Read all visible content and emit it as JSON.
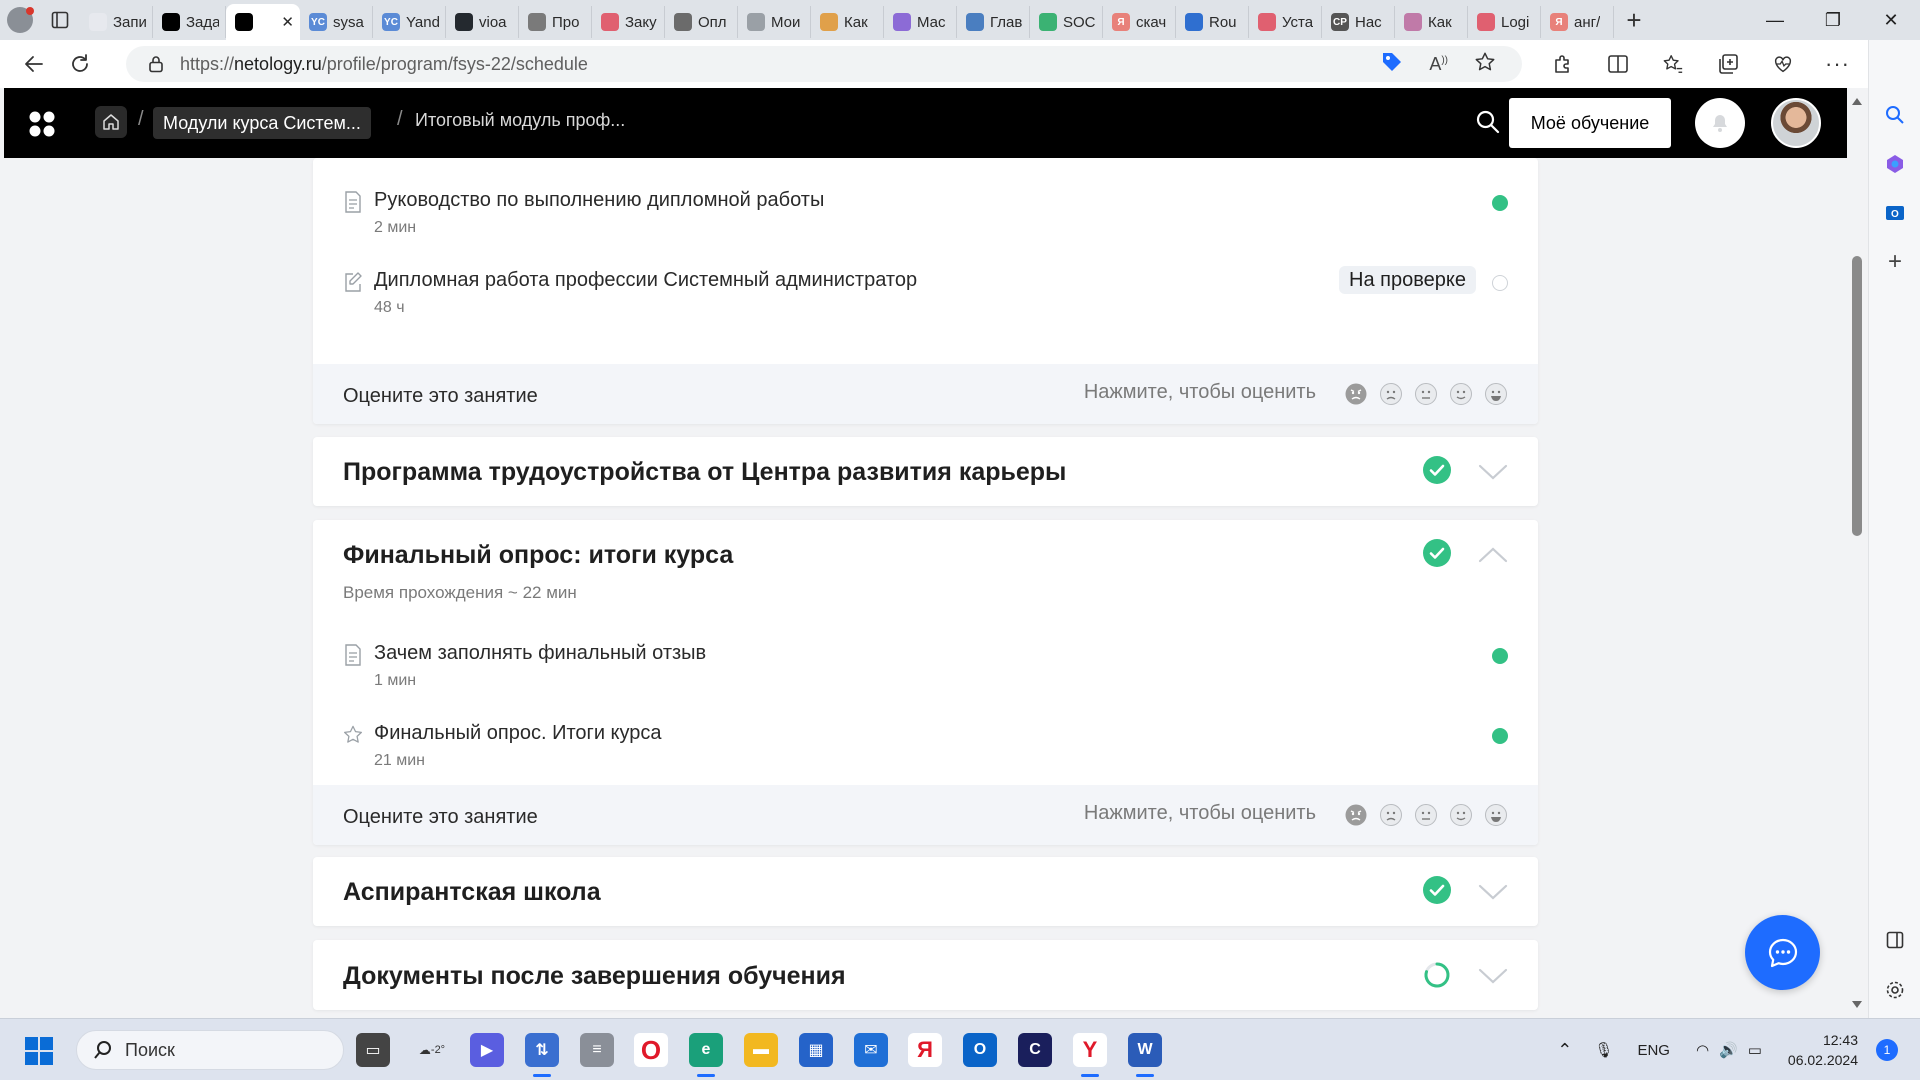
{
  "browser": {
    "tabs": [
      {
        "title": "Запи",
        "fav_color": "#e7e9ee",
        "fav_glyph": ""
      },
      {
        "title": "Зада",
        "fav_color": "#000000",
        "fav_glyph": ""
      },
      {
        "title": "",
        "fav_color": "#000000",
        "fav_glyph": "",
        "active": true
      },
      {
        "title": "sysa",
        "fav_color": "#5b8bd6",
        "fav_glyph": "YC"
      },
      {
        "title": "Yand",
        "fav_color": "#5b8bd6",
        "fav_glyph": "YC"
      },
      {
        "title": "vioa",
        "fav_color": "#24292f",
        "fav_glyph": ""
      },
      {
        "title": "Про",
        "fav_color": "#7a7a7a",
        "fav_glyph": ""
      },
      {
        "title": "Заку",
        "fav_color": "#e06070",
        "fav_glyph": ""
      },
      {
        "title": "Опл",
        "fav_color": "#6b6b6b",
        "fav_glyph": ""
      },
      {
        "title": "Мои",
        "fav_color": "#9aa0a6",
        "fav_glyph": ""
      },
      {
        "title": "Как",
        "fav_color": "#e0a04a",
        "fav_glyph": ""
      },
      {
        "title": "Мас",
        "fav_color": "#8c6bd6",
        "fav_glyph": ""
      },
      {
        "title": "Глав",
        "fav_color": "#4a7ec0",
        "fav_glyph": ""
      },
      {
        "title": "SOC",
        "fav_color": "#3bb273",
        "fav_glyph": ""
      },
      {
        "title": "скач",
        "fav_color": "#e8817a",
        "fav_glyph": "Я"
      },
      {
        "title": "Rou",
        "fav_color": "#2f6fd0",
        "fav_glyph": ""
      },
      {
        "title": "Уста",
        "fav_color": "#e06070",
        "fav_glyph": ""
      },
      {
        "title": "Нас",
        "fav_color": "#555555",
        "fav_glyph": "CP"
      },
      {
        "title": "Как",
        "fav_color": "#c07aa8",
        "fav_glyph": ""
      },
      {
        "title": "Logi",
        "fav_color": "#e06070",
        "fav_glyph": ""
      },
      {
        "title": "анг/",
        "fav_color": "#e8817a",
        "fav_glyph": "Я"
      }
    ],
    "url": {
      "prefix": "https://",
      "host": "netology.ru",
      "path": "/profile/program/fsys-22/schedule"
    }
  },
  "header": {
    "breadcrumb_module": "Модули курса Систем...",
    "breadcrumb_current": "Итоговый модуль проф...",
    "sep": "/",
    "my_learning": "Моё обучение"
  },
  "top_card": {
    "lessons": [
      {
        "title": "Руководство по выполнению дипломной работы",
        "duration": "2 мин",
        "icon": "document-icon",
        "status": "done"
      },
      {
        "title": "Дипломная работа профессии Системный администратор",
        "duration": "48 ч",
        "icon": "edit-icon",
        "status": "pending",
        "badge": "На проверке"
      }
    ],
    "rate": {
      "label": "Оцените это занятие",
      "hint": "Нажмите, чтобы оценить"
    }
  },
  "sections": [
    {
      "title": "Программа трудоустройства от Центра развития карьеры",
      "state": "collapsed",
      "complete": true
    },
    {
      "title": "Финальный опрос: итоги курса",
      "state": "expanded",
      "complete": true,
      "subtitle": "Время прохождения ~ 22 мин",
      "lessons": [
        {
          "title": "Зачем заполнять финальный отзыв",
          "duration": "1 мин",
          "icon": "document-icon",
          "status": "done"
        },
        {
          "title": "Финальный опрос. Итоги курса",
          "duration": "21 мин",
          "icon": "star-icon",
          "status": "done"
        }
      ],
      "rate": {
        "label": "Оцените это занятие",
        "hint": "Нажмите, чтобы оценить"
      }
    },
    {
      "title": "Аспирантская школа",
      "state": "collapsed",
      "complete": true
    },
    {
      "title": "Документы после завершения обучения",
      "state": "collapsed",
      "complete": false
    }
  ],
  "taskbar": {
    "search_placeholder": "Поиск",
    "weather": "-2°",
    "lang": "ENG",
    "time": "12:43",
    "date": "06.02.2024",
    "notifications": "1"
  },
  "colors": {
    "accent_green": "#33c185",
    "chat_blue": "#1e6cff",
    "header_bg": "#000000"
  }
}
